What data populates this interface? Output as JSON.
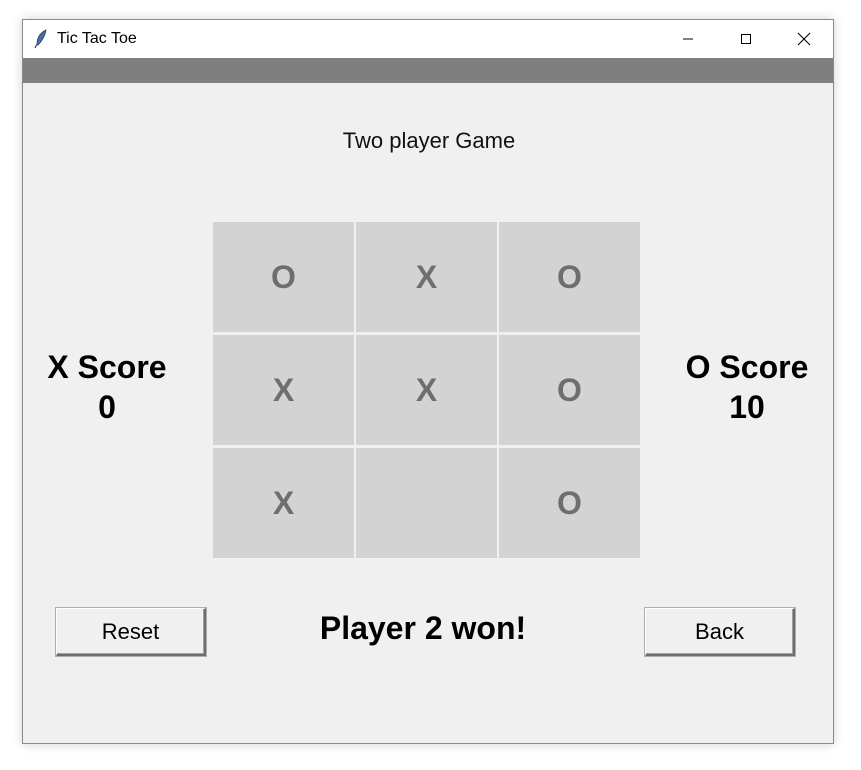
{
  "window": {
    "title": "Tic Tac Toe",
    "minimize_glyph": "–",
    "maximize_glyph": "☐",
    "close_glyph": "✕"
  },
  "game": {
    "heading": "Two player Game",
    "board": [
      "O",
      "X",
      "O",
      "X",
      "X",
      "O",
      "X",
      "",
      "O"
    ],
    "x_score_label": "X Score",
    "x_score_value": "0",
    "o_score_label": "O Score",
    "o_score_value": "10",
    "status": "Player 2 won!"
  },
  "buttons": {
    "reset_label": "Reset",
    "back_label": "Back"
  },
  "colors": {
    "menubar": "#7f7f7f",
    "cell_bg": "#d3d3d3",
    "mark_color": "#6e6e6e",
    "window_bg": "#f0f0f0"
  },
  "icons": {
    "app": "feather-icon"
  }
}
